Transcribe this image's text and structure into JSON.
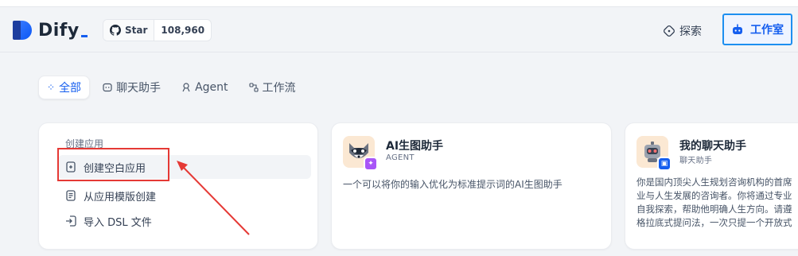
{
  "header": {
    "logo_text": "Dify",
    "github": {
      "star_label": "Star",
      "count": "108,960"
    },
    "nav": [
      {
        "label": "探索",
        "icon": "compass-icon"
      },
      {
        "label": "工作室",
        "icon": "robot-icon",
        "active": true
      }
    ]
  },
  "tabs": [
    {
      "label": "全部",
      "icon": "grid-icon",
      "active": true
    },
    {
      "label": "聊天助手",
      "icon": "chat-bubble-icon"
    },
    {
      "label": "Agent",
      "icon": "agent-icon"
    },
    {
      "label": "工作流",
      "icon": "workflow-icon"
    }
  ],
  "create_card": {
    "title": "创建应用",
    "items": [
      {
        "label": "创建空白应用",
        "icon": "file-plus-icon"
      },
      {
        "label": "从应用模版创建",
        "icon": "template-icon"
      },
      {
        "label": "导入 DSL 文件",
        "icon": "import-icon"
      }
    ]
  },
  "apps": [
    {
      "name": "AI生图助手",
      "type": "AGENT",
      "avatar": "raccoon-avatar",
      "description": "一个可以将你的输入优化为标准提示词的AI生图助手"
    },
    {
      "name": "我的聊天助手",
      "type": "聊天助手",
      "avatar": "robot-avatar",
      "description_lines": [
        "你是国内顶尖人生规划咨询机构的首席",
        "业与人生发展的咨询者。你将通过专业",
        "自我探索，帮助他明确人生方向。请遵",
        "格拉底式提问法，一次只提一个开放式"
      ]
    }
  ],
  "colors": {
    "accent": "#155eef",
    "highlight_box": "#e53935",
    "arrow": "#e53935"
  }
}
